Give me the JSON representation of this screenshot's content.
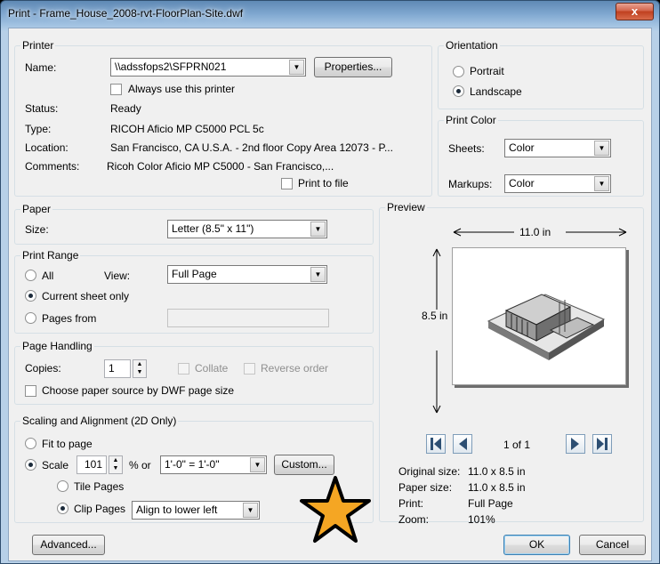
{
  "window": {
    "title": "Print - Frame_House_2008-rvt-FloorPlan-Site.dwf",
    "close_glyph": "x"
  },
  "printer": {
    "group_label": "Printer",
    "name_label": "Name:",
    "name_value": "\\\\adssfops2\\SFPRN021",
    "properties_label": "Properties...",
    "always_use_label": "Always use this printer",
    "status_label": "Status:",
    "status_value": "Ready",
    "type_label": "Type:",
    "type_value": "RICOH Aficio MP C5000 PCL 5c",
    "location_label": "Location:",
    "location_value": "San Francisco, CA U.S.A. - 2nd floor Copy Area 12073 - P...",
    "comments_label": "Comments:",
    "comments_value": "Ricoh Color Aficio MP C5000 - San Francisco,...",
    "print_to_file_label": "Print to file"
  },
  "orientation": {
    "group_label": "Orientation",
    "portrait_label": "Portrait",
    "landscape_label": "Landscape",
    "selected": "Landscape"
  },
  "print_color": {
    "group_label": "Print Color",
    "sheets_label": "Sheets:",
    "sheets_value": "Color",
    "markups_label": "Markups:",
    "markups_value": "Color"
  },
  "paper": {
    "group_label": "Paper",
    "size_label": "Size:",
    "size_value": "Letter (8.5\" x 11\")"
  },
  "print_range": {
    "group_label": "Print Range",
    "all_label": "All",
    "view_label": "View:",
    "view_value": "Full Page",
    "current_sheet_label": "Current sheet only",
    "pages_from_label": "Pages from",
    "pages_from_value": "",
    "selected": "Current sheet only"
  },
  "page_handling": {
    "group_label": "Page Handling",
    "copies_label": "Copies:",
    "copies_value": "1",
    "collate_label": "Collate",
    "reverse_order_label": "Reverse order",
    "paper_source_label": "Choose paper source by DWF page size"
  },
  "scaling": {
    "group_label": "Scaling and Alignment (2D Only)",
    "fit_label": "Fit to page",
    "scale_label": "Scale",
    "scale_value": "101",
    "percent_or_label": "% or",
    "scale_ratio_value": "1'-0\" = 1'-0\"",
    "custom_label": "Custom...",
    "tile_label": "Tile Pages",
    "clip_label": "Clip Pages",
    "align_value": "Align to lower left",
    "selected": "Scale",
    "page_mode": "Clip Pages"
  },
  "preview": {
    "group_label": "Preview",
    "width_label": "11.0 in",
    "height_label": "8.5 in",
    "page_indicator": "1 of 1",
    "original_size_label": "Original size:",
    "original_size_value": "11.0 x 8.5 in",
    "paper_size_label": "Paper size:",
    "paper_size_value": "11.0 x 8.5 in",
    "print_label": "Print:",
    "print_value": "Full Page",
    "zoom_label": "Zoom:",
    "zoom_value": "101%"
  },
  "footer": {
    "advanced_label": "Advanced...",
    "ok_label": "OK",
    "cancel_label": "Cancel"
  },
  "colors": {
    "highlight_star": "#f5a623",
    "close_button": "#c7472a"
  }
}
